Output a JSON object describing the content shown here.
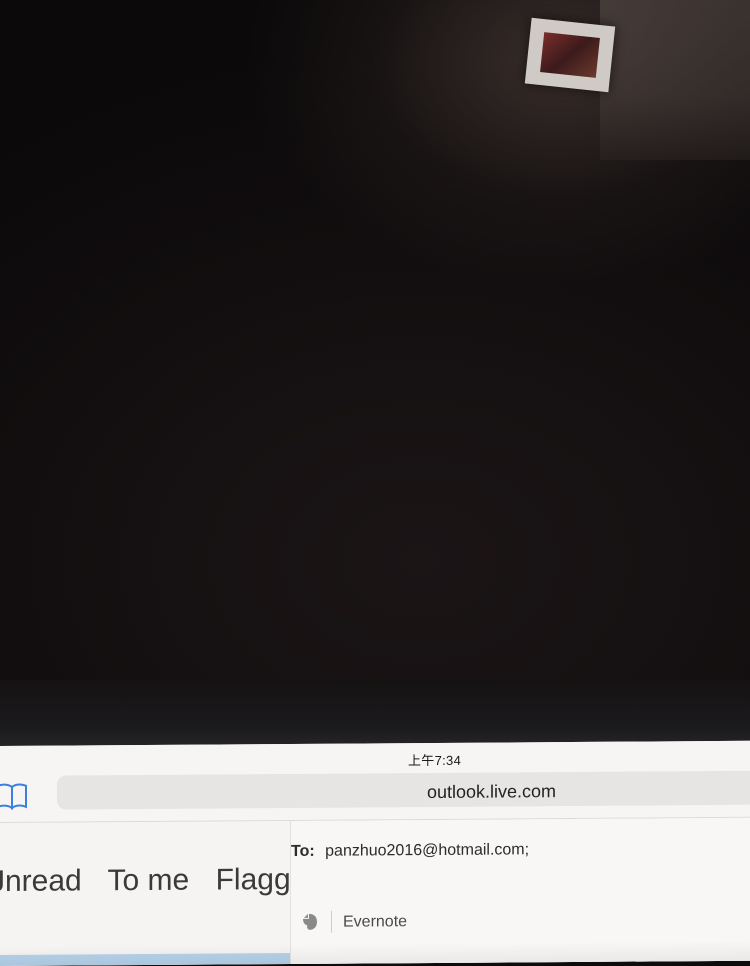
{
  "status_bar": {
    "time": "上午7:34"
  },
  "address_bar": {
    "url": "outlook.live.com",
    "bookmarks_icon": "book-icon",
    "reload_icon": "reload-icon"
  },
  "mail_filters": {
    "items": [
      {
        "label": "Jnread"
      },
      {
        "label": "To me"
      },
      {
        "label": "Flagge"
      }
    ]
  },
  "compose": {
    "to_label": "To:",
    "to_value": "panzhuo2016@hotmail.com;",
    "addin_icon": "evernote-icon",
    "addin_label": "Evernote"
  },
  "colors": {
    "screen_background": "#f4f3f1",
    "filter_selected_strip": "#b6d2ea",
    "room_background": "#0d0a0b"
  }
}
